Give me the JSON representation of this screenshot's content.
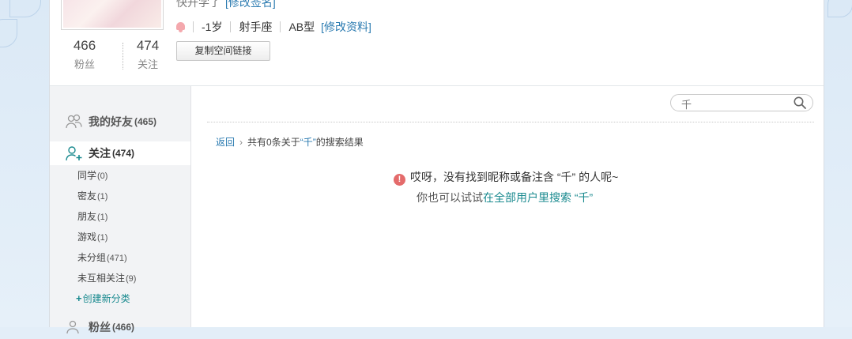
{
  "profile": {
    "signature_text": "快开学了",
    "edit_signature": "[修改签名]",
    "fans_count": "466",
    "fans_label": "粉丝",
    "follow_count": "474",
    "follow_label": "关注",
    "age": "-1岁",
    "zodiac": "射手座",
    "blood_type": "AB型",
    "edit_profile": "[修改资料]",
    "copy_link_button": "复制空间链接"
  },
  "sidebar": {
    "friends": {
      "label": "我的好友",
      "count": "(465)"
    },
    "follow": {
      "label": "关注",
      "count": "(474)"
    },
    "subgroups": [
      {
        "label": "同学",
        "count": "(0)"
      },
      {
        "label": "密友",
        "count": "(1)"
      },
      {
        "label": "朋友",
        "count": "(1)"
      },
      {
        "label": "游戏",
        "count": "(1)"
      },
      {
        "label": "未分组",
        "count": "(471)"
      },
      {
        "label": "未互相关注",
        "count": "(9)"
      }
    ],
    "new_category": "创建新分类",
    "fans": {
      "label": "粉丝",
      "count": "(466)"
    }
  },
  "search": {
    "value": "千"
  },
  "breadcrumb": {
    "back": "返回",
    "prefix": "共有0条关于",
    "keyword": "“千”",
    "suffix": "的搜索结果"
  },
  "empty_state": {
    "message": "哎呀，没有找到昵称或备注含 “千” 的人呢~",
    "hint_prefix": "你也可以试试",
    "hint_link": "在全部用户里搜索 “千”"
  },
  "colors": {
    "link": "#2a7ab0",
    "teal_link": "#1a8a8f",
    "warning": "#e46b6b"
  }
}
